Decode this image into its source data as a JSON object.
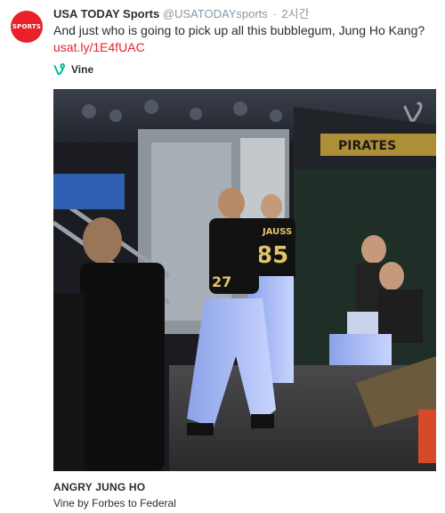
{
  "tweet": {
    "avatar_text": "SPORTS",
    "display_name": "USA TODAY Sports",
    "handle": "@USATODAYsports",
    "separator": "·",
    "timestamp": "2시간",
    "text": "And just who is going to pick up all this bubblegum, Jung Ho Kang?",
    "link": "usat.ly/1E4fUAC"
  },
  "card": {
    "provider": "Vine",
    "video_text": {
      "jersey_left_number": "27",
      "jersey_right_name": "JAUSS",
      "jersey_right_number": "85",
      "sign_text": "PIRATES"
    },
    "title": "ANGRY JUNG HO",
    "byline": "Vine by Forbes to Federal"
  },
  "colors": {
    "brand_red": "#e8212a",
    "vine_green": "#00bf8f",
    "handle_gray": "#8899a6",
    "text": "#292f33"
  }
}
